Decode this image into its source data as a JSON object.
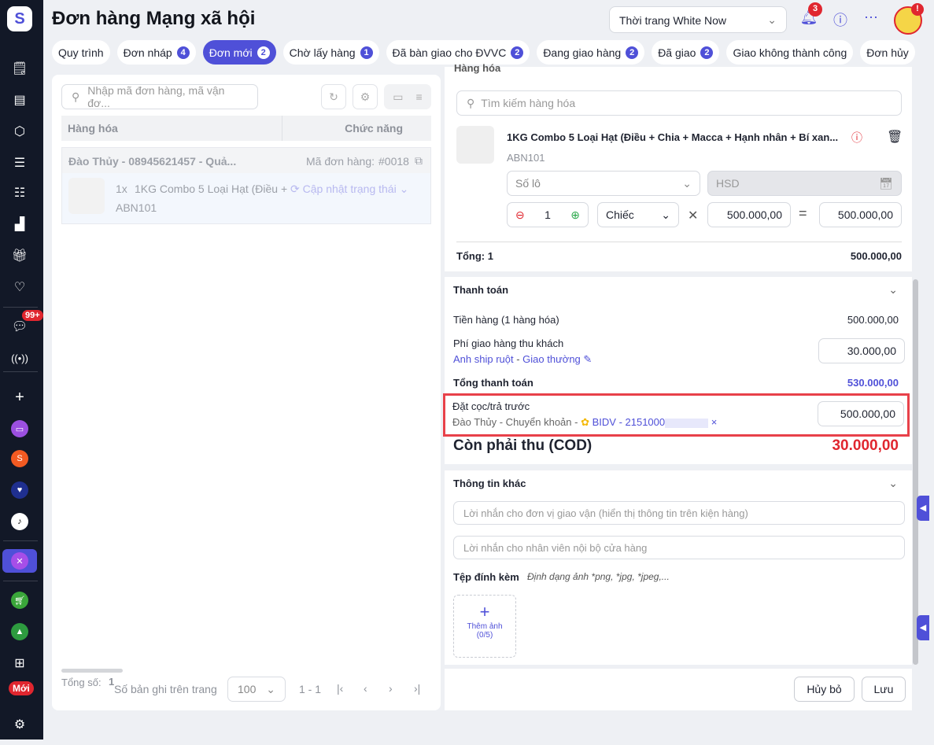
{
  "header": {
    "title": "Đơn hàng Mạng xã hội",
    "store": "Thời trang White Now",
    "notifications": "3",
    "avatar_alert": "!"
  },
  "sidebar": {
    "chat_badge": "99+",
    "new_badge": "Mới"
  },
  "tabs": [
    {
      "label": "Quy trình"
    },
    {
      "label": "Đơn nháp",
      "count": "4"
    },
    {
      "label": "Đơn mới",
      "count": "2"
    },
    {
      "label": "Chờ lấy hàng",
      "count": "1"
    },
    {
      "label": "Đã bàn giao cho ĐVVC",
      "count": "2"
    },
    {
      "label": "Đang giao hàng",
      "count": "2"
    },
    {
      "label": "Đã giao",
      "count": "2"
    },
    {
      "label": "Giao không thành công"
    },
    {
      "label": "Đơn hủy"
    }
  ],
  "list": {
    "search_placeholder": "Nhập mã đơn hàng, mã vận đơ...",
    "col_goods": "Hàng hóa",
    "col_action": "Chức năng",
    "order": {
      "customer": "Đào Thủy - 08945621457 - Quả...",
      "code_label": "Mã đơn hàng:",
      "code": "#0018",
      "qty": "1x",
      "product": "1KG Combo 5 Loại Hạt (Điều +",
      "sku": "ABN101",
      "status_action": "Cập nhật trạng thái"
    },
    "footer": {
      "total_label": "Tổng số:",
      "total": "1",
      "per_page_label": "Số bản ghi trên trang",
      "per_page": "100",
      "range": "1 - 1"
    }
  },
  "goods": {
    "section": "Hàng hóa",
    "search_placeholder": "Tìm kiếm hàng hóa",
    "product": "1KG Combo 5 Loại Hạt (Điều + Chia + Macca + Hạnh nhân + Bí xan...",
    "sku": "ABN101",
    "lot_placeholder": "Số lô",
    "hsd_placeholder": "HSD",
    "qty": "1",
    "unit": "Chiếc",
    "price": "500.000,00",
    "amount": "500.000,00",
    "total_label": "Tổng: 1",
    "total": "500.000,00"
  },
  "payment": {
    "section": "Thanh toán",
    "subtotal_label": "Tiền hàng (1 hàng hóa)",
    "subtotal": "500.000,00",
    "ship_label": "Phí giao hàng thu khách",
    "ship_fee": "30.000,00",
    "shipper": "Anh ship ruột",
    "ship_sep": " - ",
    "ship_method": "Giao thường",
    "grand_label": "Tổng thanh toán",
    "grand": "530.000,00",
    "deposit_label": "Đặt cọc/trả trước",
    "deposit_info": "Đào Thủy - Chuyển khoản - ",
    "bank": "BIDV - 2151000",
    "deposit": "500.000,00",
    "cod_label": "Còn phải thu (COD)",
    "cod": "30.000,00"
  },
  "other": {
    "section": "Thông tin khác",
    "note_carrier_placeholder": "Lời nhắn cho đơn vị giao vận (hiển thị thông tin trên kiện hàng)",
    "note_internal_placeholder": "Lời nhắn cho nhân viên nội bộ cửa hàng",
    "attach_label": "Tệp đính kèm",
    "attach_hint": "Định dạng ảnh *png, *jpg, *jpeg,...",
    "add_image": "Thêm ảnh",
    "add_count": "(0/5)"
  },
  "actions": {
    "cancel": "Hủy bỏ",
    "save": "Lưu"
  },
  "colors": {
    "accent": "#4f50d8",
    "danger": "#e0262f",
    "sidebar": "#121827"
  }
}
